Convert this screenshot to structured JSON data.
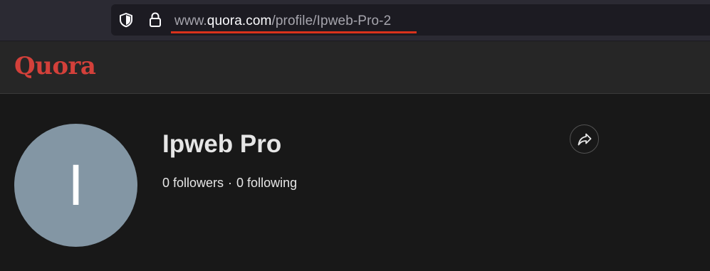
{
  "browser": {
    "url_prefix": "www.",
    "url_domain": "quora.com",
    "url_path": "/profile/Ipweb-Pro-2",
    "icons": [
      "shield-icon",
      "lock-icon"
    ]
  },
  "header": {
    "logo_text": "Quora",
    "brand_color": "#d3403a"
  },
  "profile": {
    "avatar_initial": "I",
    "avatar_color": "#8396a4",
    "name": "Ipweb Pro",
    "followers": "0 followers",
    "separator": "·",
    "following": "0 following",
    "share_icon": "share-icon"
  },
  "annotation": {
    "underline_color": "#d9321c"
  }
}
